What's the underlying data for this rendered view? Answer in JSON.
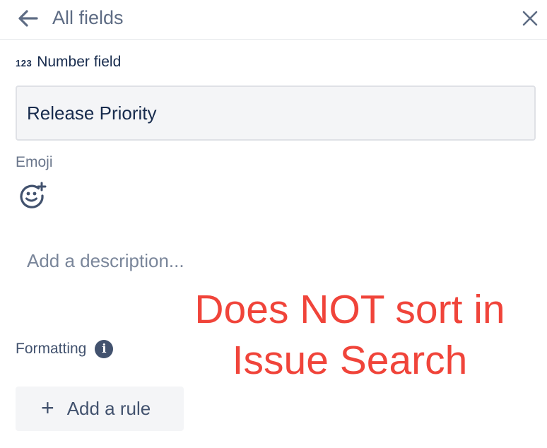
{
  "header": {
    "title": "All fields",
    "back_icon": "arrow-left-icon",
    "close_icon": "close-icon"
  },
  "field_type": {
    "icon_text": "123",
    "label": "Number field"
  },
  "name_input": {
    "value": "Release Priority"
  },
  "emoji": {
    "label": "Emoji",
    "icon": "add-emoji-icon"
  },
  "description": {
    "placeholder": "Add a description..."
  },
  "annotation": {
    "line1": "Does NOT sort in",
    "line2": "Issue Search",
    "color": "#f0443a"
  },
  "formatting": {
    "label": "Formatting",
    "info_icon_text": "i"
  },
  "add_rule": {
    "icon_text": "+",
    "label": "Add a rule"
  }
}
